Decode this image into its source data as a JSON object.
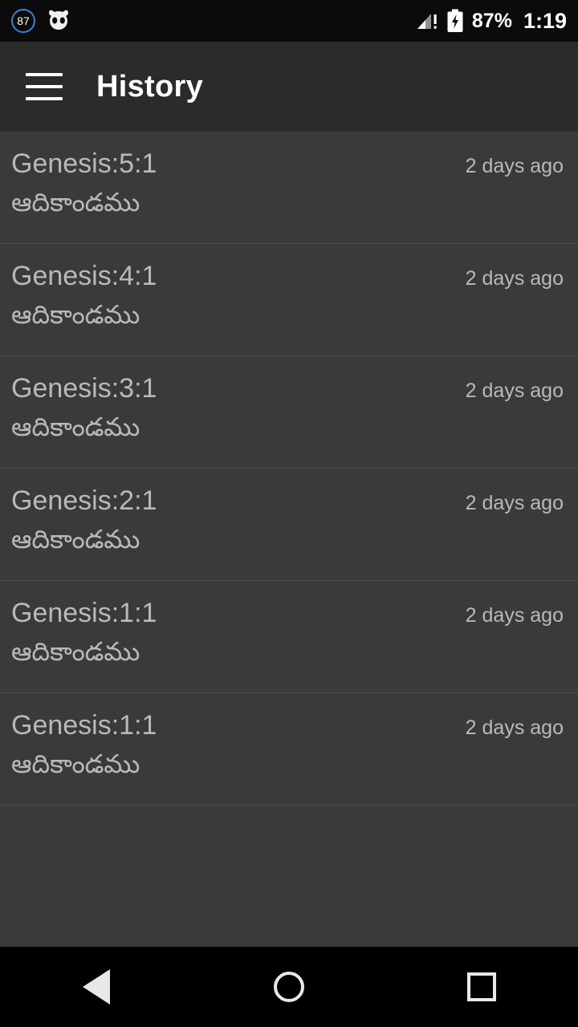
{
  "statusbar": {
    "badge_value": "87",
    "badge_icon": "circle-badge-icon",
    "alien_icon": "alien-head-icon",
    "signal_icon": "signal-warning-icon",
    "battery_icon": "battery-charging-icon",
    "battery_percent": "87%",
    "time": "1:19"
  },
  "appbar": {
    "menu_icon": "hamburger-menu-icon",
    "title": "History"
  },
  "history": {
    "items": [
      {
        "reference": "Genesis:5:1",
        "time": "2 days ago",
        "book": "ఆదికాండము"
      },
      {
        "reference": "Genesis:4:1",
        "time": "2 days ago",
        "book": "ఆదికాండము"
      },
      {
        "reference": "Genesis:3:1",
        "time": "2 days ago",
        "book": "ఆదికాండము"
      },
      {
        "reference": "Genesis:2:1",
        "time": "2 days ago",
        "book": "ఆదికాండము"
      },
      {
        "reference": "Genesis:1:1",
        "time": "2 days ago",
        "book": "ఆదికాండము"
      },
      {
        "reference": "Genesis:1:1",
        "time": "2 days ago",
        "book": "ఆదికాండము"
      }
    ]
  },
  "navbar": {
    "back_icon": "triangle-back-icon",
    "home_icon": "circle-home-icon",
    "recents_icon": "square-recents-icon"
  }
}
